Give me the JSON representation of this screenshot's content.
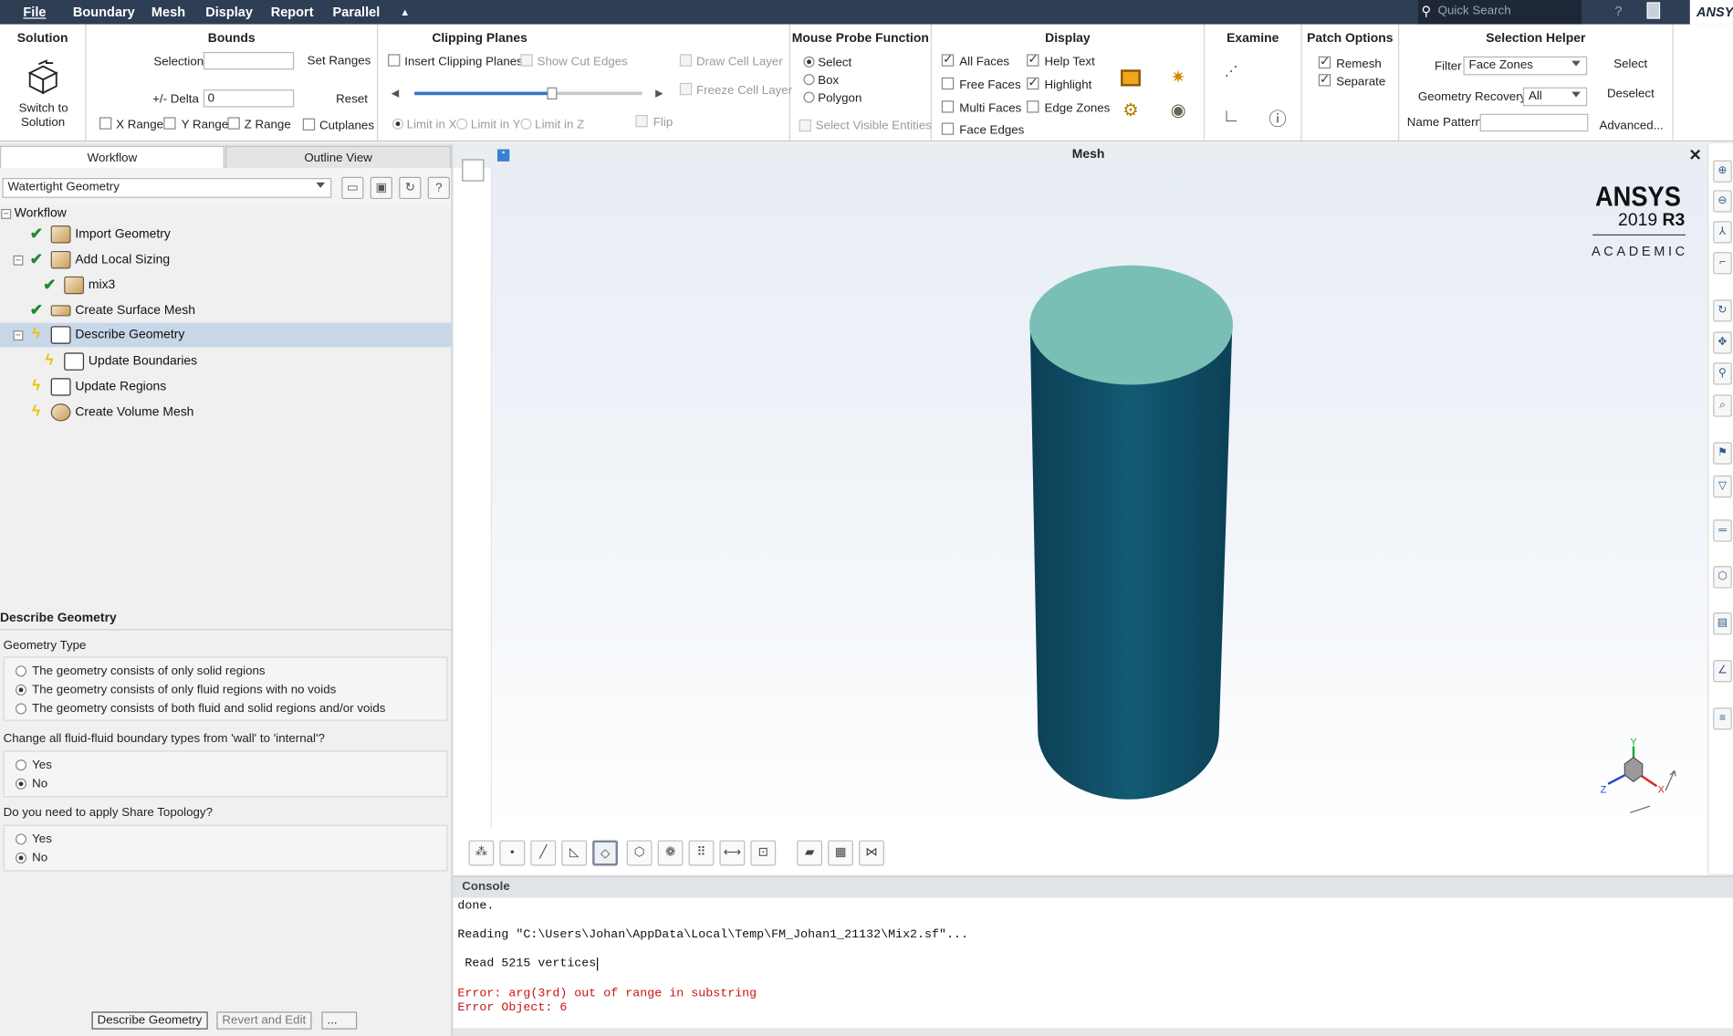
{
  "menubar": {
    "items": [
      "File",
      "Boundary",
      "Mesh",
      "Display",
      "Report",
      "Parallel"
    ],
    "collapse_glyph": "▲",
    "search_placeholder": "Quick Search",
    "brand_tab": "ANSYS"
  },
  "ribbon": {
    "solution": {
      "title": "Solution",
      "button_line1": "Switch to",
      "button_line2": "Solution",
      "icon": "cube-arrow-icon"
    },
    "bounds": {
      "title": "Bounds",
      "selection_label": "Selection",
      "selection_value": "",
      "set_ranges": "Set Ranges",
      "delta_label": "+/- Delta",
      "delta_value": "0",
      "reset": "Reset",
      "x_range": "X Range",
      "y_range": "Y Range",
      "z_range": "Z Range",
      "cutplanes": "Cutplanes"
    },
    "clipping": {
      "title": "Clipping Planes",
      "insert": "Insert Clipping Planes",
      "show_cut_edges": "Show Cut Edges",
      "draw_cell_layer": "Draw Cell Layer",
      "freeze_cell_layer": "Freeze Cell Layer",
      "limit_x": "Limit in X",
      "limit_y": "Limit in Y",
      "limit_z": "Limit in Z",
      "flip": "Flip",
      "slider_value": 0.6
    },
    "probe": {
      "title": "Mouse Probe Function",
      "select": "Select",
      "box": "Box",
      "polygon": "Polygon",
      "visible_entities": "Select Visible Entities"
    },
    "display": {
      "title": "Display",
      "all_faces": "All Faces",
      "free_faces": "Free Faces",
      "multi_faces": "Multi Faces",
      "face_edges": "Face Edges",
      "help_text": "Help Text",
      "highlight": "Highlight",
      "edge_zones": "Edge Zones"
    },
    "examine": {
      "title": "Examine"
    },
    "patch": {
      "title": "Patch Options",
      "remesh": "Remesh",
      "separate": "Separate"
    },
    "selection_helper": {
      "title": "Selection Helper",
      "filter_label": "Filter",
      "filter_value": "Face Zones",
      "select": "Select",
      "geometry_recovery_label": "Geometry Recovery",
      "geometry_recovery_value": "All",
      "deselect": "Deselect",
      "name_pattern_label": "Name Pattern",
      "name_pattern_value": "",
      "advanced": "Advanced..."
    }
  },
  "left_panel": {
    "tabs": [
      "Workflow",
      "Outline View"
    ],
    "workflow_select": "Watertight Geometry",
    "tree": [
      {
        "label": "Workflow",
        "state": "root",
        "icon": "minus"
      },
      {
        "label": "Import Geometry",
        "state": "done",
        "icon": "import-geometry-icon"
      },
      {
        "label": "Add Local Sizing",
        "state": "done",
        "icon": "local-sizing-icon"
      },
      {
        "label": "mix3",
        "state": "done",
        "icon": "sizing-child-icon"
      },
      {
        "label": "Create Surface Mesh",
        "state": "done",
        "icon": "surface-mesh-icon"
      },
      {
        "label": "Describe Geometry",
        "state": "pending",
        "icon": "describe-geometry-icon"
      },
      {
        "label": "Update Boundaries",
        "state": "pending",
        "icon": "update-boundaries-icon"
      },
      {
        "label": "Update Regions",
        "state": "pending",
        "icon": "update-regions-icon"
      },
      {
        "label": "Create Volume Mesh",
        "state": "pending",
        "icon": "volume-mesh-icon"
      }
    ],
    "task": {
      "title": "Describe Geometry",
      "geometry_type_label": "Geometry Type",
      "geometry_options": [
        "The geometry consists of only solid regions",
        "The geometry consists of only fluid regions with no voids",
        "The geometry consists of both fluid and solid regions and/or voids"
      ],
      "geometry_selected": 1,
      "fluid_question": "Change all fluid-fluid boundary types from 'wall' to 'internal'?",
      "fluid_options": [
        "Yes",
        "No"
      ],
      "fluid_selected": 1,
      "share_question": "Do you need to apply Share Topology?",
      "share_options": [
        "Yes",
        "No"
      ],
      "share_selected": 1
    },
    "buttons": {
      "describe": "Describe Geometry",
      "revert": "Revert and Edit",
      "more": "..."
    }
  },
  "graphics": {
    "title": "Mesh",
    "close": "✕",
    "logo_brand": "ANSYS",
    "logo_version": "2019",
    "logo_release": "R3",
    "logo_edition": "ACADEMIC",
    "triad_x": "X",
    "triad_y": "Y",
    "triad_z": "Z",
    "colors": {
      "cylinder_side": "#0f4d66",
      "cylinder_top": "#79bfb6"
    }
  },
  "console": {
    "title": "Console",
    "lines": [
      {
        "text": "done.",
        "error": false
      },
      {
        "text": "Reading \"C:\\Users\\Johan\\AppData\\Local\\Temp\\FM_Johan1_21132\\Mix2.sf\"...",
        "error": false
      },
      {
        "text": " Read 5215 vertices",
        "error": false
      },
      {
        "text": "Error: arg(3rd) out of range in substring",
        "error": true
      },
      {
        "text": "Error Object: 6",
        "error": true
      }
    ]
  }
}
